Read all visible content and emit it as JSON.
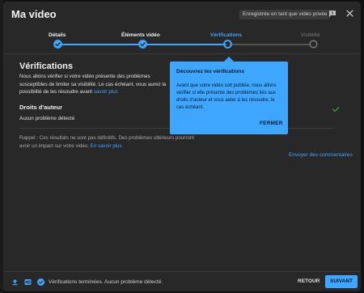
{
  "header": {
    "title": "Ma video",
    "draft_badge": "Enregistrée en tant que vidéo privée"
  },
  "steps": [
    {
      "label": "Détails",
      "state": "done"
    },
    {
      "label": "Éléments vidéo",
      "state": "done"
    },
    {
      "label": "Vérifications",
      "state": "active"
    },
    {
      "label": "Visibilité",
      "state": "inactive"
    }
  ],
  "main": {
    "heading": "Vérifications",
    "intro": "Nous allons vérifier si votre vidéo présente des problèmes susceptibles de limiter sa visibilité. Le cas échéant, vous aurez la possibilité de les résoudre avant",
    "intro_link": "savoir plus",
    "copyright_title": "Droits d'auteur",
    "copyright_status": "Aucun problème détecté",
    "reminder": "Rappel : Ces résultats ne sont pas définitifs. Des problèmes ultérieurs pourront avoir un impact sur votre vidéo.",
    "reminder_link": "En savoir plus",
    "send_feedback": "Envoyer des commentaires"
  },
  "popup": {
    "title": "Découvrez les vérifications",
    "body": "Avant que votre vidéo soit publiée, nous allons vérifier si elle présente des problèmes liés aux droits d'auteur et vous aider à les résoudre, le cas échéant.",
    "close_label": "FERMER"
  },
  "footer": {
    "status": "Vérifications terminées. Aucun problème détecté.",
    "back_label": "RETOUR",
    "next_label": "SUIVANT"
  },
  "icons": {
    "upload": "upload-icon",
    "hd": "hd-icon",
    "check_circle": "check-circle-icon",
    "feedback": "feedback-icon",
    "close": "close-icon",
    "check": "check-icon"
  },
  "colors": {
    "accent": "#3ea6ff",
    "dialog_bg": "#282828",
    "success": "#2ba640"
  }
}
